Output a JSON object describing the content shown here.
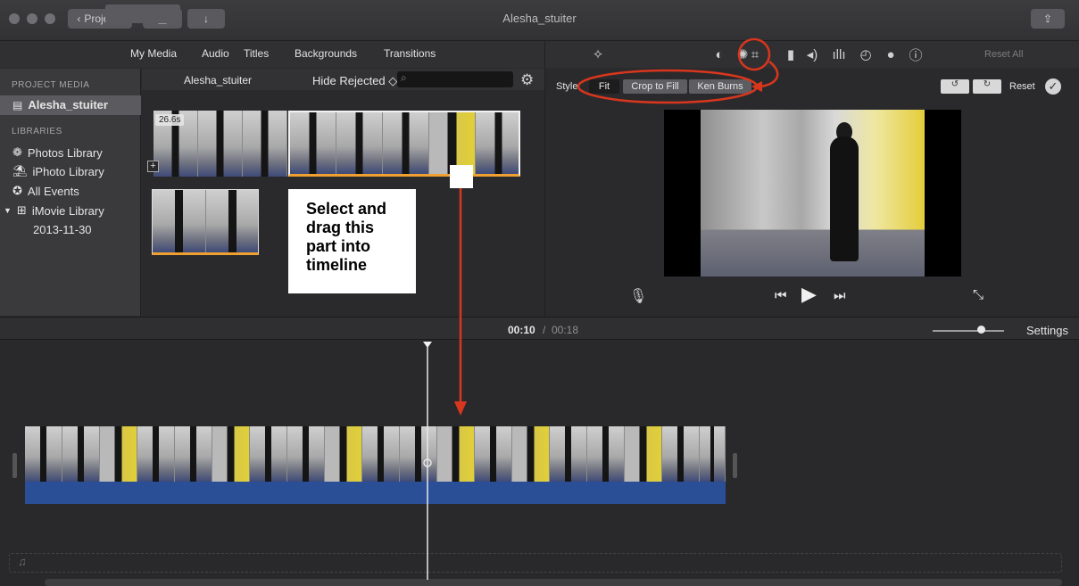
{
  "window": {
    "title": "Alesha_stuiter",
    "projects_button": "Projects"
  },
  "media_tabs": [
    "My Media",
    "Audio",
    "Titles",
    "Backgrounds",
    "Transitions"
  ],
  "sidebar": {
    "project_header": "PROJECT MEDIA",
    "project_item": "Alesha_stuiter",
    "libraries_header": "LIBRARIES",
    "items": [
      {
        "label": "Photos Library",
        "icon": "photos-icon"
      },
      {
        "label": "iPhoto Library",
        "icon": "iphoto-icon"
      },
      {
        "label": "All Events",
        "icon": "star-icon"
      },
      {
        "label": "iMovie Library",
        "icon": "grid-icon"
      }
    ],
    "event": "2013-11-30"
  },
  "browser": {
    "event_name": "Alesha_stuiter",
    "filter": "Hide Rejected ◇",
    "search_placeholder": "",
    "clip_duration": "26.6s"
  },
  "viewer": {
    "reset_all": "Reset All",
    "style_label": "Style:",
    "styles": [
      "Fit",
      "Crop to Fill",
      "Ken Burns"
    ],
    "reset": "Reset"
  },
  "timeline": {
    "current_time": "00:10",
    "separator": "/",
    "total_time": "00:18",
    "settings": "Settings"
  },
  "annotation": {
    "lines": [
      "Select and",
      "drag this",
      "part into",
      "timeline"
    ]
  },
  "colors": {
    "accent_red": "#d9361e",
    "audio_blue": "#2a4f97",
    "selection_orange": "#f0a030"
  }
}
